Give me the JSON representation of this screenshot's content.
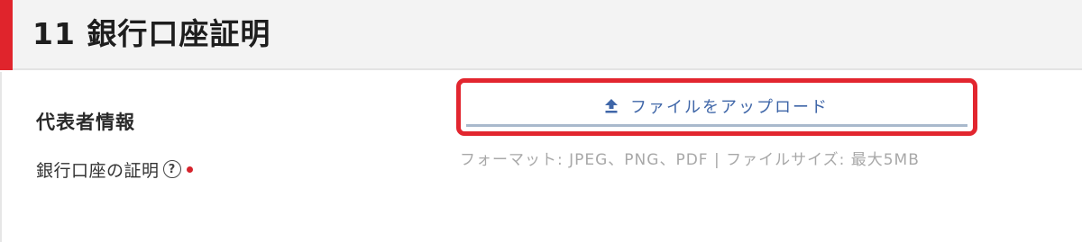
{
  "section": {
    "title": "11 銀行口座証明"
  },
  "subsection": {
    "title": "代表者情報"
  },
  "field": {
    "label": "銀行口座の証明",
    "help_symbol": "?",
    "required": true,
    "help_icon": "question-circle-icon",
    "required_icon": "required-dot-icon"
  },
  "upload": {
    "label": "ファイルをアップロード",
    "icon": "upload-icon"
  },
  "hint": {
    "text": "フォーマット: JPEG、PNG、PDF | ファイルサイズ: 最大5MB"
  },
  "colors": {
    "accent": "#e0242c",
    "link_blue": "#3f66a8",
    "highlight_red": "#e2262f",
    "required_red": "#d6232c"
  }
}
